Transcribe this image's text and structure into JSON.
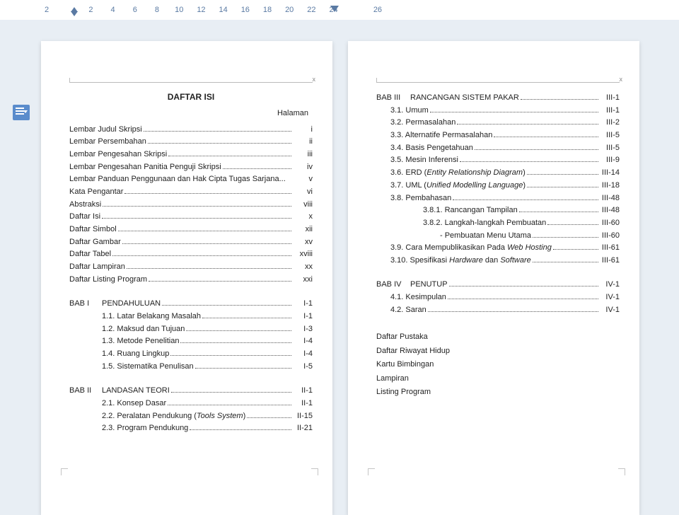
{
  "ruler": {
    "ticks": [
      "2",
      "",
      "2",
      "4",
      "6",
      "8",
      "10",
      "12",
      "14",
      "16",
      "18",
      "20",
      "22",
      "24",
      "",
      "26"
    ]
  },
  "doc": {
    "title": "DAFTAR ISI",
    "halaman_label": "Halaman",
    "front_matter": [
      {
        "label": "Lembar Judul Skripsi",
        "page": "i"
      },
      {
        "label": "Lembar Persembahan",
        "page": "ii"
      },
      {
        "label": "Lembar Pengesahan Skripsi",
        "page": "iii"
      },
      {
        "label": "Lembar Pengesahan Panitia Penguji Skripsi",
        "page": "iv"
      },
      {
        "label": "Lembar Panduan Penggunaan dan Hak Cipta Tugas Sarjana...",
        "page": "v",
        "no_dots": true
      },
      {
        "label": "Kata Pengantar",
        "page": "vi"
      },
      {
        "label": "Abstraksi",
        "page": "viii"
      },
      {
        "label": "Daftar Isi",
        "page": "x"
      },
      {
        "label": "Daftar Simbol",
        "page": "xii"
      },
      {
        "label": "Daftar Gambar",
        "page": "xv"
      },
      {
        "label": "Daftar Tabel",
        "page": "xviii"
      },
      {
        "label": "Daftar Lampiran",
        "page": "xx"
      },
      {
        "label": "Daftar Listing Program",
        "page": "xxi"
      }
    ],
    "bab1": {
      "bab": "BAB I",
      "title": "PENDAHULUAN",
      "page": "I-1",
      "items": [
        {
          "label": "1.1. Latar Belakang Masalah",
          "page": "I-1"
        },
        {
          "label": "1.2. Maksud dan Tujuan",
          "page": "I-3"
        },
        {
          "label": "1.3. Metode Penelitian",
          "page": "I-4"
        },
        {
          "label": "1.4. Ruang Lingkup",
          "page": "I-4"
        },
        {
          "label": "1.5. Sistematika Penulisan",
          "page": "I-5"
        }
      ]
    },
    "bab2": {
      "bab": "BAB II",
      "title": "LANDASAN TEORI",
      "page": "II-1",
      "items": [
        {
          "label": "2.1. Konsep Dasar",
          "page": "II-1"
        },
        {
          "label_html": "2.2. Peralatan Pendukung (<i>Tools System</i>)",
          "page": "II-15"
        },
        {
          "label": "2.3. Program Pendukung",
          "page": "II-21"
        }
      ]
    },
    "bab3": {
      "bab": "BAB III",
      "title": "RANCANGAN SISTEM PAKAR",
      "page": "III-1",
      "items": [
        {
          "label": "3.1. Umum",
          "page": "III-1",
          "indent": "indent2"
        },
        {
          "label": "3.2. Permasalahan",
          "page": "III-2",
          "indent": "indent2"
        },
        {
          "label": "3.3. Alternatife Permasalahan",
          "page": "III-5",
          "indent": "indent2"
        },
        {
          "label": "3.4. Basis Pengetahuan",
          "page": "III-5",
          "indent": "indent2"
        },
        {
          "label": "3.5. Mesin Inferensi",
          "page": "III-9",
          "indent": "indent2"
        },
        {
          "label_html": "3.6. ERD (<i>Entity Relationship Diagram</i>)",
          "page": "III-14",
          "indent": "indent2"
        },
        {
          "label_html": "3.7. UML (<i>Unified Modelling Language</i>)",
          "page": "III-18",
          "indent": "indent2"
        },
        {
          "label": "3.8. Pembahasan",
          "page": "III-48",
          "indent": "indent2"
        },
        {
          "label": "3.8.1. Rancangan Tampilan",
          "page": "III-48",
          "indent": "indent3"
        },
        {
          "label": "3.8.2. Langkah-langkah Pembuatan",
          "page": "III-60",
          "indent": "indent3"
        },
        {
          "label": "- Pembuatan Menu Utama",
          "page": "III-60",
          "indent": "indent4"
        },
        {
          "label_html": "3.9. Cara Mempublikasikan Pada <i>Web Hosting</i>",
          "page": "III-61",
          "indent": "indent2"
        },
        {
          "label_html": "3.10. Spesifikasi <i>Hardware</i> dan <i>Software</i>",
          "page": "III-61",
          "indent": "indent2"
        }
      ]
    },
    "bab4": {
      "bab": "BAB IV",
      "title": "PENUTUP",
      "page": "IV-1",
      "items": [
        {
          "label": "4.1. Kesimpulan",
          "page": "IV-1",
          "indent": "indent2"
        },
        {
          "label": "4.2. Saran",
          "page": "IV-1",
          "indent": "indent2"
        }
      ]
    },
    "appendix": [
      "Daftar Pustaka",
      "Daftar Riwayat Hidup",
      "Kartu Bimbingan",
      "Lampiran",
      "Listing Program"
    ]
  }
}
